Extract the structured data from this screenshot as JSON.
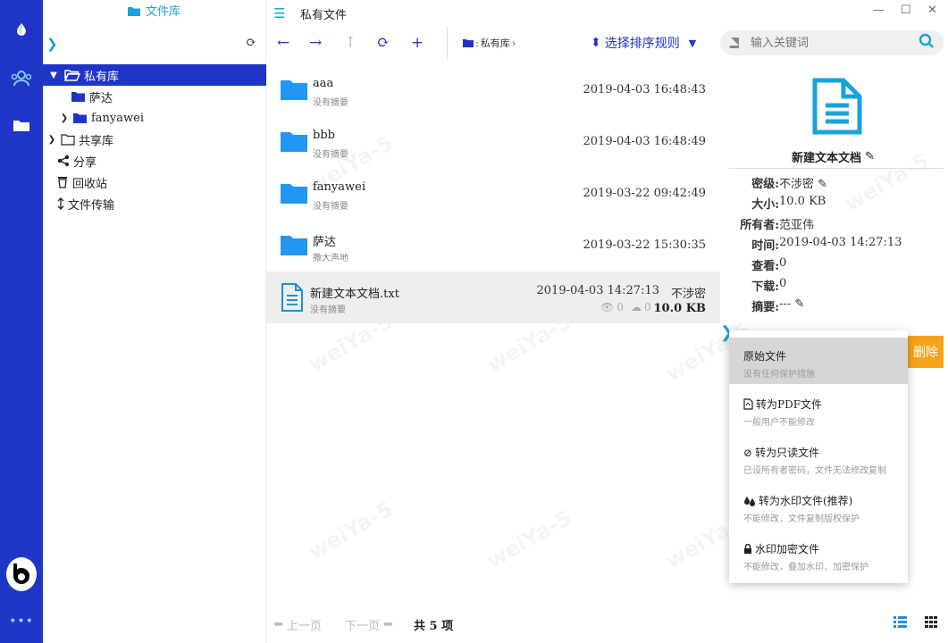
{
  "app": {
    "library_title": "文件库",
    "page_title": "私有文件"
  },
  "tree": {
    "items": [
      {
        "label": "私有库"
      },
      {
        "label": "萨达"
      },
      {
        "label": "fanyawei"
      },
      {
        "label": "共享库"
      },
      {
        "label": "分享"
      },
      {
        "label": "回收站"
      },
      {
        "label": "文件传输"
      }
    ]
  },
  "toolbar": {
    "breadcrumb": "私有库",
    "sort_label": "选择排序规则",
    "search_placeholder": "输入关键词"
  },
  "files": [
    {
      "name": "aaa",
      "summary": "没有摘要",
      "time": "2019-04-03 16:48:43"
    },
    {
      "name": "bbb",
      "summary": "没有摘要",
      "time": "2019-04-03 16:48:49"
    },
    {
      "name": "fanyawei",
      "summary": "没有摘要",
      "time": "2019-03-22 09:42:49"
    },
    {
      "name": "萨达",
      "summary": "撒大声地",
      "time": "2019-03-22 15:30:35"
    },
    {
      "name": "新建文本文档.txt",
      "summary": "没有摘要",
      "time": "2019-04-03 14:27:13",
      "security": "不涉密",
      "views": "0",
      "downloads": "0",
      "size": "10.0 KB"
    }
  ],
  "details": {
    "title": "新建文本文档",
    "security_label": "密级:",
    "security_value": "不涉密",
    "size_label": "大小:",
    "size_value": "10.0 KB",
    "owner_label": "所有者:",
    "owner_value": "范亚伟",
    "time_label": "时间:",
    "time_value": "2019-04-03 14:27:13",
    "views_label": "查看:",
    "views_value": "0",
    "downloads_label": "下载:",
    "downloads_value": "0",
    "summary_label": "摘要:",
    "summary_value": "---",
    "delete_label": "删除"
  },
  "menu": {
    "items": [
      {
        "title": "原始文件",
        "desc": "没有任何保护措施"
      },
      {
        "title": "转为PDF文件",
        "desc": "一般用户不能修改"
      },
      {
        "title": "转为只读文件",
        "desc": "已设所有者密码，文件无法修改复制"
      },
      {
        "title": "转为水印文件(推荐)",
        "desc": "不能修改，文件复制版权保护"
      },
      {
        "title": "水印加密文件",
        "desc": "不能修改，叠加水印，加密保护"
      }
    ]
  },
  "footer": {
    "prev_label": "上一页",
    "next_label": "下一页",
    "total_label": "共 5 项"
  },
  "watermark": "weiYa-5",
  "colors": {
    "rail": "#1e35c8",
    "accent": "#1aa3d9",
    "folder": "#2196f3",
    "delete": "#f7a21b"
  }
}
